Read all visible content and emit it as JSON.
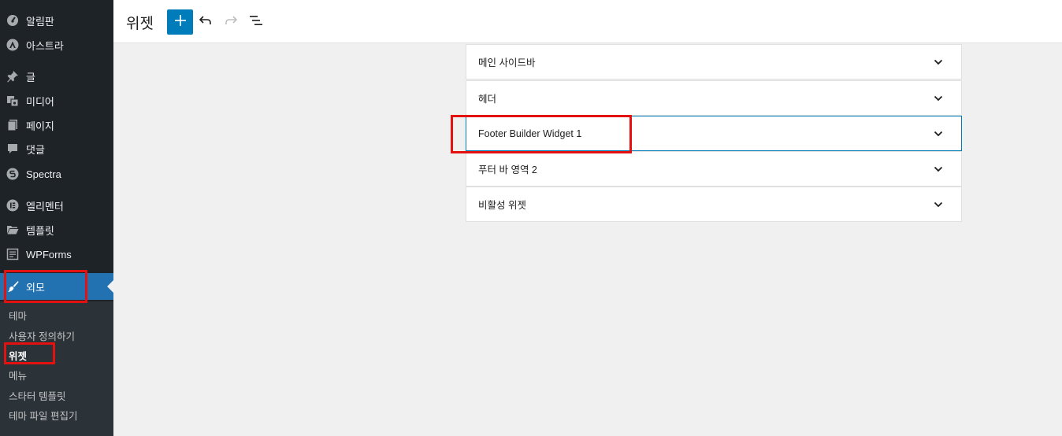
{
  "sidebar": {
    "items": [
      {
        "label": "알림판",
        "icon": "dashboard-icon"
      },
      {
        "label": "아스트라",
        "icon": "astra-icon"
      },
      {
        "label": "글",
        "icon": "pin-icon"
      },
      {
        "label": "미디어",
        "icon": "media-icon"
      },
      {
        "label": "페이지",
        "icon": "pages-icon"
      },
      {
        "label": "댓글",
        "icon": "comments-icon"
      },
      {
        "label": "Spectra",
        "icon": "spectra-icon"
      },
      {
        "label": "엘리멘터",
        "icon": "elementor-icon"
      },
      {
        "label": "템플릿",
        "icon": "folder-icon"
      },
      {
        "label": "WPForms",
        "icon": "wpforms-icon"
      },
      {
        "label": "외모",
        "icon": "brush-icon"
      }
    ],
    "submenu": [
      {
        "label": "테마"
      },
      {
        "label": "사용자 정의하기"
      },
      {
        "label": "위젯"
      },
      {
        "label": "메뉴"
      },
      {
        "label": "스타터 템플릿"
      },
      {
        "label": "테마 파일 편집기"
      }
    ]
  },
  "header": {
    "title": "위젯",
    "add_icon": "plus-icon",
    "undo_icon": "undo-icon",
    "redo_icon": "redo-icon",
    "list_view_icon": "list-view-icon"
  },
  "widget_areas": [
    {
      "label": "메인 사이드바"
    },
    {
      "label": "헤더"
    },
    {
      "label": "Footer Builder Widget 1"
    },
    {
      "label": "푸터 바 영역 2"
    },
    {
      "label": "비활성 위젯"
    }
  ],
  "colors": {
    "sidebar_bg": "#1d2327",
    "submenu_bg": "#2c3338",
    "accent": "#2271b1",
    "primary_button": "#007cba",
    "highlight": "#e41111"
  }
}
